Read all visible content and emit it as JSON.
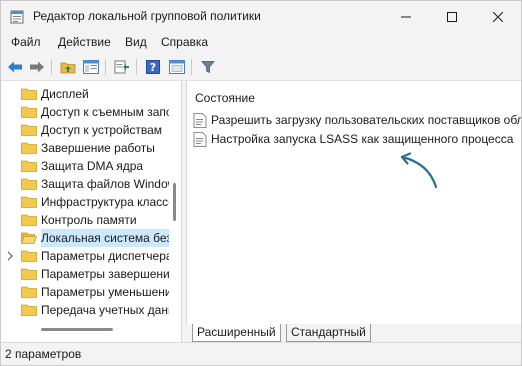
{
  "window": {
    "title": "Редактор локальной групповой политики"
  },
  "menu": {
    "items": [
      "Файл",
      "Действие",
      "Вид",
      "Справка"
    ]
  },
  "toolbar": {
    "icons": [
      "back-arrow",
      "forward-arrow",
      "up-folder",
      "show-hide-tree",
      "export-list",
      "help",
      "properties",
      "filter"
    ]
  },
  "tree": {
    "items": [
      {
        "label": "Дисплей",
        "expandable": false,
        "selected": false
      },
      {
        "label": "Доступ к съемным запоминающим устройствам",
        "expandable": false,
        "selected": false
      },
      {
        "label": "Доступ к устройствам",
        "expandable": false,
        "selected": false
      },
      {
        "label": "Завершение работы",
        "expandable": false,
        "selected": false
      },
      {
        "label": "Защита DMA ядра",
        "expandable": false,
        "selected": false
      },
      {
        "label": "Защита файлов Windows",
        "expandable": false,
        "selected": false
      },
      {
        "label": "Инфраструктура классов",
        "expandable": false,
        "selected": false
      },
      {
        "label": "Контроль памяти",
        "expandable": false,
        "selected": false
      },
      {
        "label": "Локальная система безопасности",
        "expandable": false,
        "selected": true
      },
      {
        "label": "Параметры диспетчера",
        "expandable": true,
        "selected": false
      },
      {
        "label": "Параметры завершения",
        "expandable": false,
        "selected": false
      },
      {
        "label": "Параметры уменьшения",
        "expandable": false,
        "selected": false
      },
      {
        "label": "Передача учетных данных",
        "expandable": false,
        "selected": false
      }
    ]
  },
  "list": {
    "column_header": "Состояние",
    "rows": [
      {
        "label": "Разрешить загрузку пользовательских поставщиков обл"
      },
      {
        "label": "Настройка запуска LSASS как защищенного процесса"
      }
    ]
  },
  "tabs": {
    "extended": "Расширенный",
    "standard": "Стандартный"
  },
  "status": {
    "text": "2 параметров"
  },
  "colors": {
    "selection": "#cce8ff",
    "annotation_arrow": "#2a6f97",
    "folder": "#f2c94c"
  }
}
